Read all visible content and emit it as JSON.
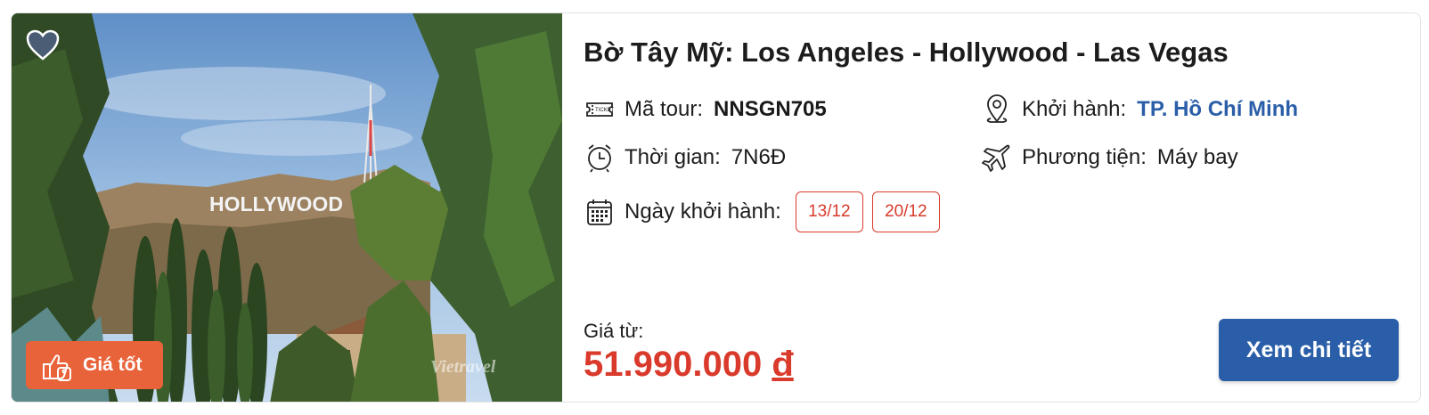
{
  "tour": {
    "title": "Bờ Tây Mỹ: Los Angeles - Hollywood - Las Vegas",
    "code_label": "Mã tour:",
    "code_value": "NNSGN705",
    "departure_label": "Khởi hành:",
    "departure_value": "TP. Hồ Chí Minh",
    "duration_label": "Thời gian:",
    "duration_value": "7N6Đ",
    "transport_label": "Phương tiện:",
    "transport_value": "Máy bay",
    "dates_label": "Ngày khởi hành:",
    "dates": [
      "13/12",
      "20/12"
    ],
    "price_label": "Giá từ:",
    "price_value": "51.990.000",
    "price_currency": "đ",
    "cta_label": "Xem chi tiết"
  },
  "image": {
    "sign_text": "HOLLYWOOD",
    "badge_label": "Giá tốt",
    "watermark": "Vietravel"
  },
  "icons": {
    "favorite": "heart-icon",
    "badge": "thumbs-up-price-tag-icon",
    "code": "ticket-icon",
    "departure": "map-pin-icon",
    "duration": "alarm-clock-icon",
    "transport": "airplane-icon",
    "dates": "calendar-icon"
  },
  "colors": {
    "accent_blue": "#2a5ea8",
    "price_red": "#d93a2b",
    "badge_orange": "#e8633a"
  }
}
